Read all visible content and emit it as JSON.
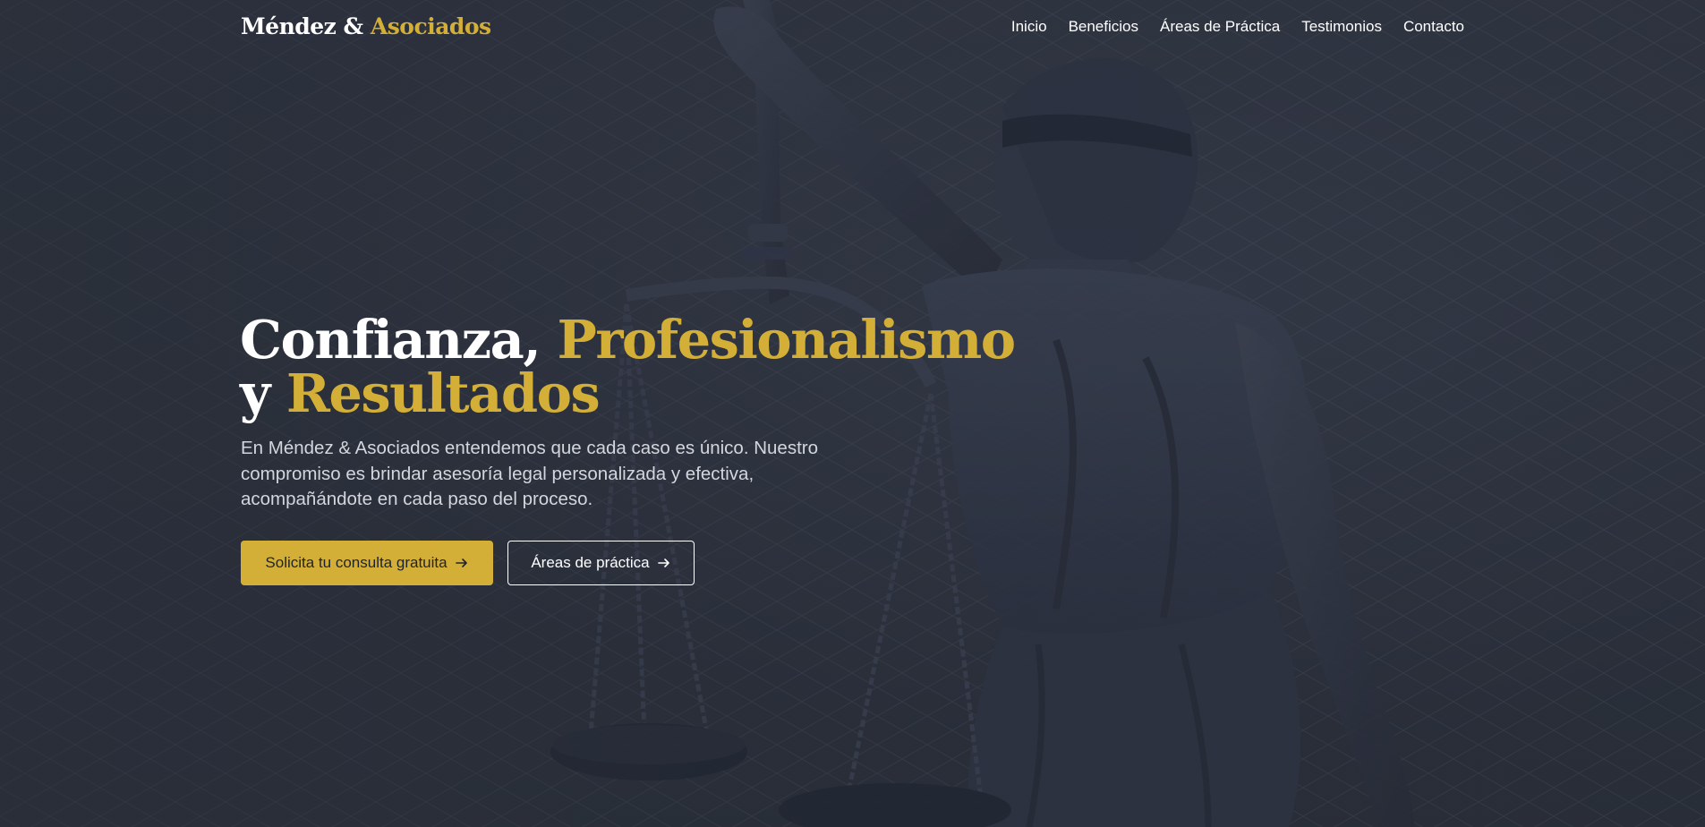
{
  "brand": {
    "name_part1": "Méndez & ",
    "name_part2": "Asociados",
    "accent_color": "#d4af37"
  },
  "nav": {
    "items": [
      {
        "label": "Inicio"
      },
      {
        "label": "Beneficios"
      },
      {
        "label": "Áreas de Práctica"
      },
      {
        "label": "Testimonios"
      },
      {
        "label": "Contacto"
      }
    ]
  },
  "hero": {
    "headline_part1": "Confianza, ",
    "headline_part2": "Profesionalismo",
    "headline_part3": "y ",
    "headline_part4": "Resultados",
    "subtitle": "En Méndez & Asociados entendemos que cada caso es único. Nuestro compromiso es brindar asesoría legal personalizada y efectiva, acompañándote en cada paso del proceso.",
    "primary_button": {
      "label": "Solicita tu consulta gratuita",
      "icon": "arrow-right-icon"
    },
    "secondary_button": {
      "label": "Áreas de práctica",
      "icon": "arrow-right-icon"
    },
    "background_image": "lady-justice-statue"
  }
}
